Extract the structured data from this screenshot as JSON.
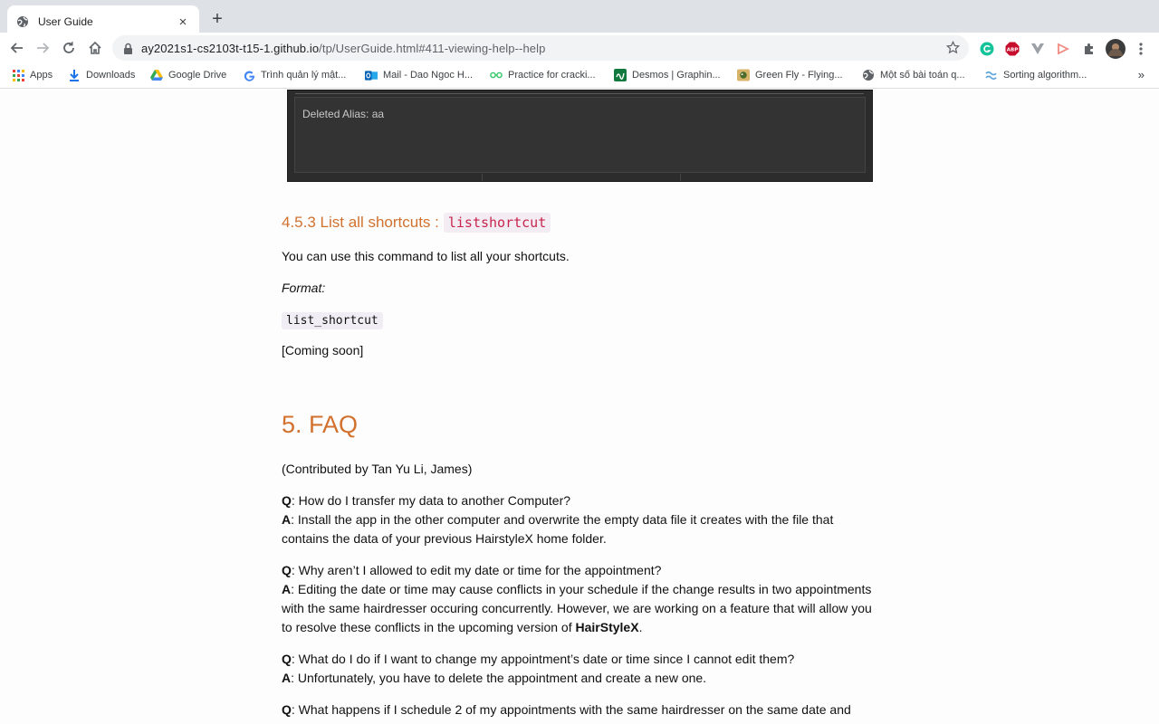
{
  "tab": {
    "title": "User Guide",
    "close": "×",
    "new": "+"
  },
  "address": {
    "host": "ay2021s1-cs2103t-t15-1.github.io",
    "path": "/tp/UserGuide.html#411-viewing-help--help"
  },
  "bookmarks": [
    {
      "label": "Apps"
    },
    {
      "label": "Downloads"
    },
    {
      "label": "Google Drive"
    },
    {
      "label": "Trình quản lý mật..."
    },
    {
      "label": "Mail - Dao Ngoc H..."
    },
    {
      "label": "Practice for cracki..."
    },
    {
      "label": "Desmos | Graphin..."
    },
    {
      "label": "Green Fly - Flying..."
    },
    {
      "label": "Một số bài toán q..."
    },
    {
      "label": "Sorting algorithm..."
    }
  ],
  "bookmarks_more": "»",
  "screenshot": {
    "text": "Deleted Alias: aa"
  },
  "section_453": {
    "heading": "4.5.3 List all shortcuts :",
    "heading_code": "listshortcut",
    "desc": "You can use this command to list all your shortcuts.",
    "format_label": "Format:",
    "format_code": "list_shortcut",
    "note": "[Coming soon]"
  },
  "faq": {
    "heading": "5. FAQ",
    "contrib": "(Contributed by Tan Yu Li, James)",
    "items": [
      {
        "q_label": "Q",
        "q": ": How do I transfer my data to another Computer?",
        "a_label": "A",
        "a": ": Install the app in the other computer and overwrite the empty data file it creates with the file that contains the data of your previous HairstyleX home folder."
      },
      {
        "q_label": "Q",
        "q": ": Why aren’t I allowed to edit my date or time for the appointment?",
        "a_label": "A",
        "a": ": Editing the date or time may cause conflicts in your schedule if the change results in two appointments with the same hairdresser occuring concurrently. However, we are working on a feature that will allow you to resolve these conflicts in the upcoming version of ",
        "a_bold": "HairStyleX",
        "a_end": "."
      },
      {
        "q_label": "Q",
        "q": ": What do I do if I want to change my appointment’s date or time since I cannot edit them?",
        "a_label": "A",
        "a": ": Unfortunately, you have to delete the appointment and create a new one."
      },
      {
        "q_label": "Q",
        "q": ": What happens if I schedule 2 of my appointments with the same hairdresser on the same date and"
      }
    ]
  }
}
